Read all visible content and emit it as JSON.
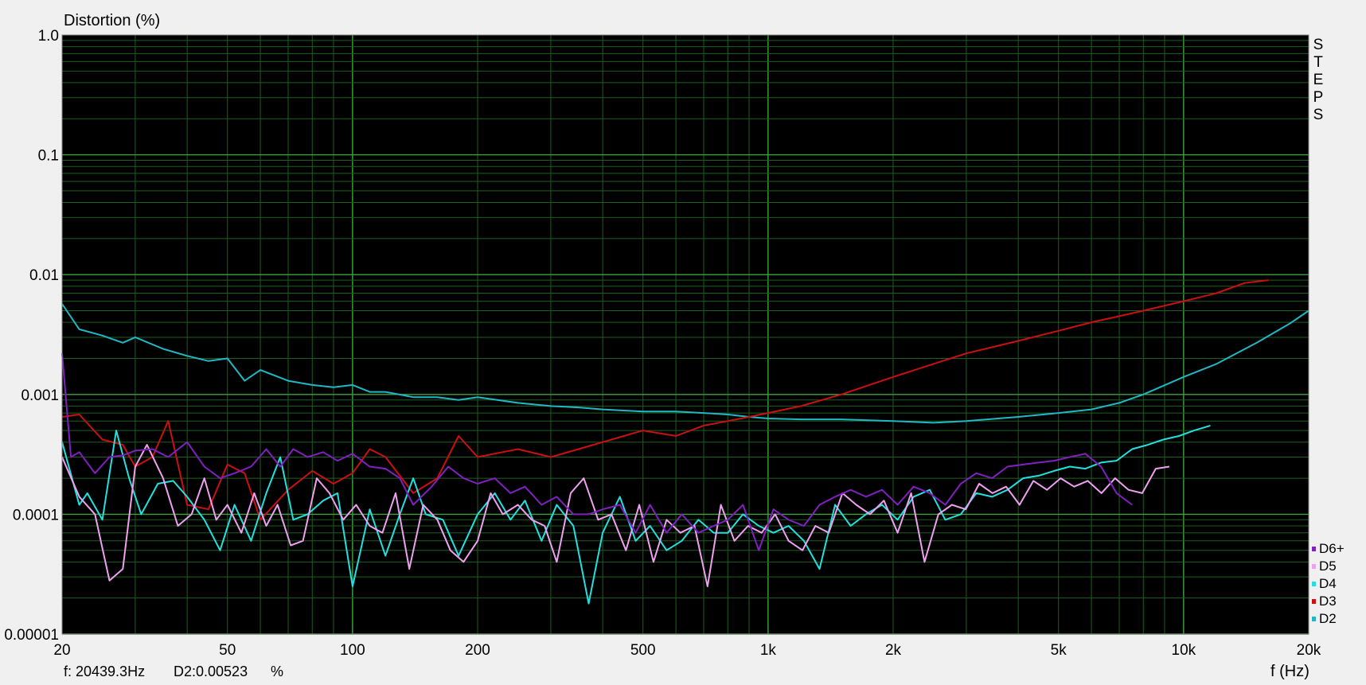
{
  "chart_data": {
    "type": "line",
    "title": "",
    "ylabel": "Distortion (%)",
    "xlabel": "f (Hz)",
    "x_scale": "log",
    "y_scale": "log",
    "xlim": [
      20,
      20000
    ],
    "ylim": [
      1e-05,
      1.0
    ],
    "grid": true,
    "legend_position": "bottom-right",
    "x_ticks": [
      {
        "value": 20,
        "label": "20"
      },
      {
        "value": 50,
        "label": "50"
      },
      {
        "value": 100,
        "label": "100"
      },
      {
        "value": 200,
        "label": "200"
      },
      {
        "value": 500,
        "label": "500"
      },
      {
        "value": 1000,
        "label": "1k"
      },
      {
        "value": 2000,
        "label": "2k"
      },
      {
        "value": 5000,
        "label": "5k"
      },
      {
        "value": 10000,
        "label": "10k"
      },
      {
        "value": 20000,
        "label": "20k"
      }
    ],
    "y_ticks": [
      {
        "value": 1.0,
        "label": "1.0"
      },
      {
        "value": 0.1,
        "label": "0.1"
      },
      {
        "value": 0.01,
        "label": "0.01"
      },
      {
        "value": 0.001,
        "label": "0.001"
      },
      {
        "value": 0.0001,
        "label": "0.0001"
      },
      {
        "value": 1e-05,
        "label": "0.00001"
      }
    ],
    "side_label": "STEPS",
    "series": [
      {
        "name": "D2",
        "color": "#1fb8c4",
        "x": [
          20,
          22,
          25,
          28,
          30,
          35,
          40,
          45,
          50,
          55,
          60,
          70,
          80,
          90,
          100,
          110,
          120,
          140,
          160,
          180,
          200,
          250,
          300,
          350,
          400,
          500,
          600,
          700,
          800,
          900,
          1000,
          1200,
          1500,
          2000,
          2500,
          3000,
          4000,
          5000,
          6000,
          7000,
          8000,
          10000,
          12000,
          15000,
          18000,
          20000
        ],
        "y": [
          0.0057,
          0.0035,
          0.0031,
          0.0027,
          0.003,
          0.0024,
          0.0021,
          0.0019,
          0.002,
          0.0013,
          0.0016,
          0.0013,
          0.0012,
          0.00115,
          0.0012,
          0.00105,
          0.00105,
          0.00095,
          0.00095,
          0.0009,
          0.00095,
          0.00085,
          0.0008,
          0.00078,
          0.00075,
          0.00072,
          0.00072,
          0.0007,
          0.00068,
          0.00065,
          0.00063,
          0.00062,
          0.00062,
          0.0006,
          0.00058,
          0.0006,
          0.00065,
          0.0007,
          0.00075,
          0.00085,
          0.001,
          0.0014,
          0.0018,
          0.0027,
          0.0039,
          0.005
        ]
      },
      {
        "name": "D3",
        "color": "#cc1010",
        "x": [
          20,
          22,
          25,
          28,
          30,
          33,
          36,
          40,
          45,
          50,
          55,
          60,
          70,
          80,
          90,
          100,
          110,
          120,
          140,
          160,
          180,
          200,
          250,
          300,
          350,
          400,
          500,
          600,
          700,
          800,
          900,
          1000,
          1200,
          1500,
          2000,
          2500,
          3000,
          4000,
          5000,
          6000,
          7000,
          8000,
          10000,
          12000,
          14000,
          16000
        ],
        "y": [
          0.00065,
          0.00068,
          0.00042,
          0.00038,
          0.00025,
          0.0003,
          0.0006,
          0.00012,
          0.00011,
          0.00026,
          0.00022,
          9e-05,
          0.00016,
          0.00023,
          0.00018,
          0.00022,
          0.00035,
          0.0003,
          0.00015,
          0.0002,
          0.00045,
          0.0003,
          0.00035,
          0.0003,
          0.00035,
          0.0004,
          0.0005,
          0.00045,
          0.00055,
          0.0006,
          0.00065,
          0.0007,
          0.0008,
          0.001,
          0.0014,
          0.0018,
          0.0022,
          0.0028,
          0.0034,
          0.004,
          0.0045,
          0.005,
          0.006,
          0.007,
          0.0085,
          0.009
        ]
      },
      {
        "name": "D4",
        "color": "#22e0e0",
        "x": [
          20,
          22,
          23,
          25,
          27,
          29,
          31,
          34,
          37,
          40,
          44,
          48,
          52,
          57,
          62,
          67,
          72,
          78,
          85,
          92,
          100,
          110,
          120,
          130,
          140,
          150,
          165,
          180,
          200,
          220,
          240,
          260,
          285,
          310,
          340,
          370,
          400,
          440,
          480,
          520,
          570,
          620,
          680,
          740,
          800,
          870,
          950,
          1030,
          1120,
          1220,
          1330,
          1450,
          1580,
          1720,
          1880,
          2050,
          2240,
          2450,
          2670,
          2910,
          3170,
          3460,
          3770,
          4110,
          4480,
          4880,
          5320,
          5800,
          6330,
          6900,
          7520,
          8200,
          8940,
          9750,
          10600,
          11600
        ],
        "y": [
          0.0004,
          0.00012,
          0.00015,
          9e-05,
          0.0005,
          0.0002,
          0.0001,
          0.00018,
          0.00019,
          0.00014,
          9e-05,
          5e-05,
          0.00012,
          6e-05,
          0.00015,
          0.0003,
          9e-05,
          0.0001,
          0.00013,
          0.00015,
          2.5e-05,
          0.00011,
          4.5e-05,
          0.0001,
          0.0002,
          0.0001,
          9e-05,
          4.5e-05,
          0.0001,
          0.00015,
          9e-05,
          0.00013,
          6e-05,
          0.00012,
          8e-05,
          1.8e-05,
          7e-05,
          0.00014,
          6e-05,
          8e-05,
          5e-05,
          6e-05,
          9e-05,
          7e-05,
          7e-05,
          0.0001,
          8e-05,
          7e-05,
          8e-05,
          6e-05,
          3.5e-05,
          0.00012,
          8e-05,
          0.0001,
          0.00012,
          9e-05,
          0.00014,
          0.00016,
          9e-05,
          0.0001,
          0.00015,
          0.00014,
          0.00016,
          0.0002,
          0.00021,
          0.00023,
          0.00025,
          0.00024,
          0.00027,
          0.00028,
          0.00035,
          0.00038,
          0.00042,
          0.00045,
          0.0005,
          0.00055
        ]
      },
      {
        "name": "D5",
        "color": "#f0a0f0",
        "x": [
          20,
          22,
          24,
          26,
          28,
          30,
          32,
          35,
          38,
          41,
          44,
          47,
          50,
          54,
          58,
          62,
          66,
          71,
          76,
          82,
          88,
          95,
          102,
          110,
          118,
          127,
          137,
          148,
          160,
          172,
          185,
          200,
          215,
          230,
          250,
          270,
          290,
          310,
          335,
          360,
          390,
          420,
          455,
          490,
          530,
          570,
          615,
          665,
          715,
          770,
          830,
          895,
          965,
          1040,
          1120,
          1210,
          1300,
          1400,
          1510,
          1630,
          1760,
          1900,
          2050,
          2210,
          2380,
          2570,
          2770,
          2990,
          3220,
          3470,
          3740,
          4030,
          4350,
          4690,
          5060,
          5450,
          5880,
          6340,
          6840,
          7370,
          7950,
          8570,
          9240
        ],
        "y": [
          0.0003,
          0.00014,
          0.0001,
          2.8e-05,
          3.5e-05,
          0.00025,
          0.00038,
          0.0002,
          8e-05,
          0.0001,
          0.0002,
          9e-05,
          0.00012,
          7e-05,
          0.00015,
          8e-05,
          0.00012,
          5.5e-05,
          6e-05,
          0.0002,
          0.00015,
          9e-05,
          0.00012,
          8e-05,
          7e-05,
          0.00015,
          3.5e-05,
          0.00012,
          9e-05,
          5e-05,
          4e-05,
          6e-05,
          0.00015,
          0.0001,
          0.00012,
          9e-05,
          8e-05,
          4e-05,
          0.00015,
          0.0002,
          9e-05,
          0.0001,
          5e-05,
          0.00012,
          4e-05,
          9e-05,
          7e-05,
          8e-05,
          2.5e-05,
          0.00012,
          6e-05,
          8e-05,
          7e-05,
          0.0001,
          6e-05,
          5e-05,
          8e-05,
          7e-05,
          0.00015,
          0.00012,
          0.0001,
          0.00013,
          7e-05,
          0.00015,
          4e-05,
          0.0001,
          0.00012,
          0.00011,
          0.00018,
          0.00015,
          0.00017,
          0.00012,
          0.00019,
          0.00016,
          0.0002,
          0.00017,
          0.00019,
          0.00015,
          0.0002,
          0.00016,
          0.00015,
          0.00024,
          0.00025
        ]
      },
      {
        "name": "D6+",
        "color": "#8020c0",
        "x": [
          20,
          21,
          22,
          24,
          26,
          28,
          30,
          33,
          36,
          40,
          44,
          48,
          52,
          57,
          62,
          67,
          72,
          78,
          85,
          92,
          100,
          110,
          120,
          130,
          140,
          155,
          170,
          185,
          200,
          220,
          240,
          260,
          285,
          310,
          340,
          370,
          400,
          440,
          480,
          520,
          570,
          620,
          680,
          740,
          800,
          870,
          950,
          1030,
          1120,
          1220,
          1330,
          1450,
          1580,
          1720,
          1880,
          2050,
          2240,
          2450,
          2670,
          2910,
          3170,
          3460,
          3770,
          4110,
          4480,
          4880,
          5320,
          5800,
          6330,
          6900,
          7520
        ],
        "y": [
          0.0022,
          0.0003,
          0.00033,
          0.00022,
          0.0003,
          0.00031,
          0.00034,
          0.00035,
          0.0003,
          0.0004,
          0.00025,
          0.0002,
          0.00022,
          0.00025,
          0.00035,
          0.00025,
          0.00035,
          0.0003,
          0.00033,
          0.00028,
          0.00032,
          0.00025,
          0.00024,
          0.0002,
          0.00012,
          0.00017,
          0.00025,
          0.0002,
          0.00018,
          0.0002,
          0.00015,
          0.00017,
          0.00012,
          0.00014,
          0.0001,
          0.0001,
          0.00011,
          0.00012,
          7e-05,
          0.00012,
          7e-05,
          0.0001,
          7e-05,
          8e-05,
          9e-05,
          0.00012,
          5e-05,
          0.00011,
          9e-05,
          8e-05,
          0.00012,
          0.00014,
          0.00016,
          0.00014,
          0.00016,
          0.00012,
          0.00017,
          0.00015,
          0.00012,
          0.00018,
          0.00022,
          0.0002,
          0.00025,
          0.00026,
          0.00027,
          0.00028,
          0.0003,
          0.00032,
          0.00025,
          0.00015,
          0.00012
        ]
      }
    ]
  },
  "readout": {
    "freq": "f: 20439.3Hz",
    "value": "D2:0.00523",
    "unit": "%"
  }
}
